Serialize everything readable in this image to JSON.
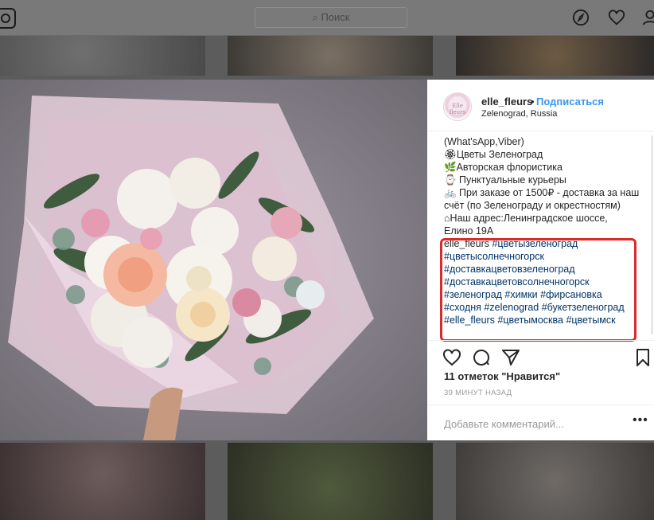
{
  "topbar": {
    "search_placeholder": "Поиск",
    "icons": [
      "instagram-icon",
      "search-icon",
      "explore-icon",
      "heart-icon",
      "profile-icon"
    ]
  },
  "post": {
    "username": "elle_fleurs",
    "separator": "•",
    "follow_label": "Подписаться",
    "location": "Zelenograd, Russia",
    "avatar_text": "Elle fleurs",
    "caption_lines": [
      "(What'sApp,Viber)",
      "🏵Цветы Зеленоград",
      "🌿Авторская флористика",
      "⌚ Пунктуальные курьеры",
      "🚲 При заказе от 1500₽ - доставка за наш",
      "счёт (по Зеленограду и окрестностям)",
      "⌂Наш адрес:Ленинградское шоссе,",
      "Елино 19А"
    ],
    "hashtag_user": "elle_fleurs",
    "hashtag_lines": [
      "#цветызеленоград",
      "#цветысолнечногорск",
      "#доставкацветовзеленоград",
      "#доставкацветовсолнечногорск",
      "#зеленоград #химки #фирсановка",
      "#сходня #zelenograd #букетзеленоград",
      "#elle_fleurs #цветымосква #цветымск"
    ],
    "likes": "11 отметок \"Нравится\"",
    "time": "39 МИНУТ НАЗАД",
    "comment_placeholder": "Добавьте комментарий...",
    "more_label": "•••"
  },
  "colors": {
    "link_blue": "#3897f0",
    "hashtag": "#003569",
    "highlight_box": "#d82c2c",
    "text": "#262626"
  }
}
